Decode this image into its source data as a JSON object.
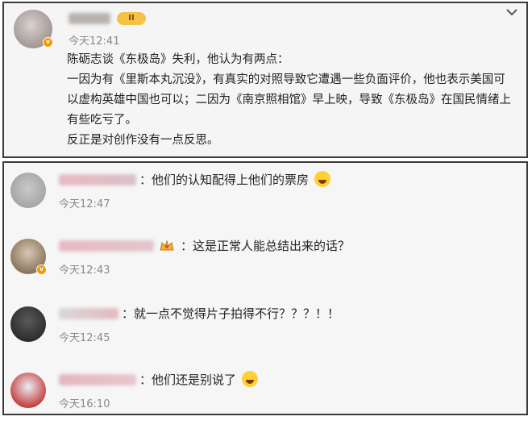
{
  "post": {
    "time": "今天12:41",
    "level_badge": "II",
    "lines": [
      "陈砺志谈《东极岛》失利，他认为有两点：",
      "一因为有《里斯本丸沉没》，有真实的对照导致它遭遇一些负面评价，他也表示美国可",
      "以虚构英雄中国也可以；二因为《南京照相馆》早上映，导致《东极岛》在国民情绪上",
      "有些吃亏了。",
      "反正是对创作没有一点反思。"
    ],
    "menu_icon": "chevron-down-icon"
  },
  "comments": [
    {
      "text": "：他们的认知配得上他们的票房",
      "time": "今天12:47",
      "emoji": "grinning-sweat-emoji",
      "has_vip": false,
      "has_crown": false
    },
    {
      "text": "：这是正常人能总结出来的话？",
      "time": "今天12:43",
      "emoji": "",
      "has_vip": true,
      "has_crown": true
    },
    {
      "text": "：就一点不觉得片子拍得不行？？？！！",
      "time": "今天12:45",
      "emoji": "",
      "has_vip": false,
      "has_crown": false
    },
    {
      "text": "：他们还是别说了",
      "time": "今天16:10",
      "emoji": "laughing-tears-emoji",
      "has_vip": false,
      "has_crown": false
    }
  ],
  "colors": {
    "verified_badge": "#f39800",
    "time_text": "#8a8a8a",
    "border": "#3a3a3a"
  }
}
